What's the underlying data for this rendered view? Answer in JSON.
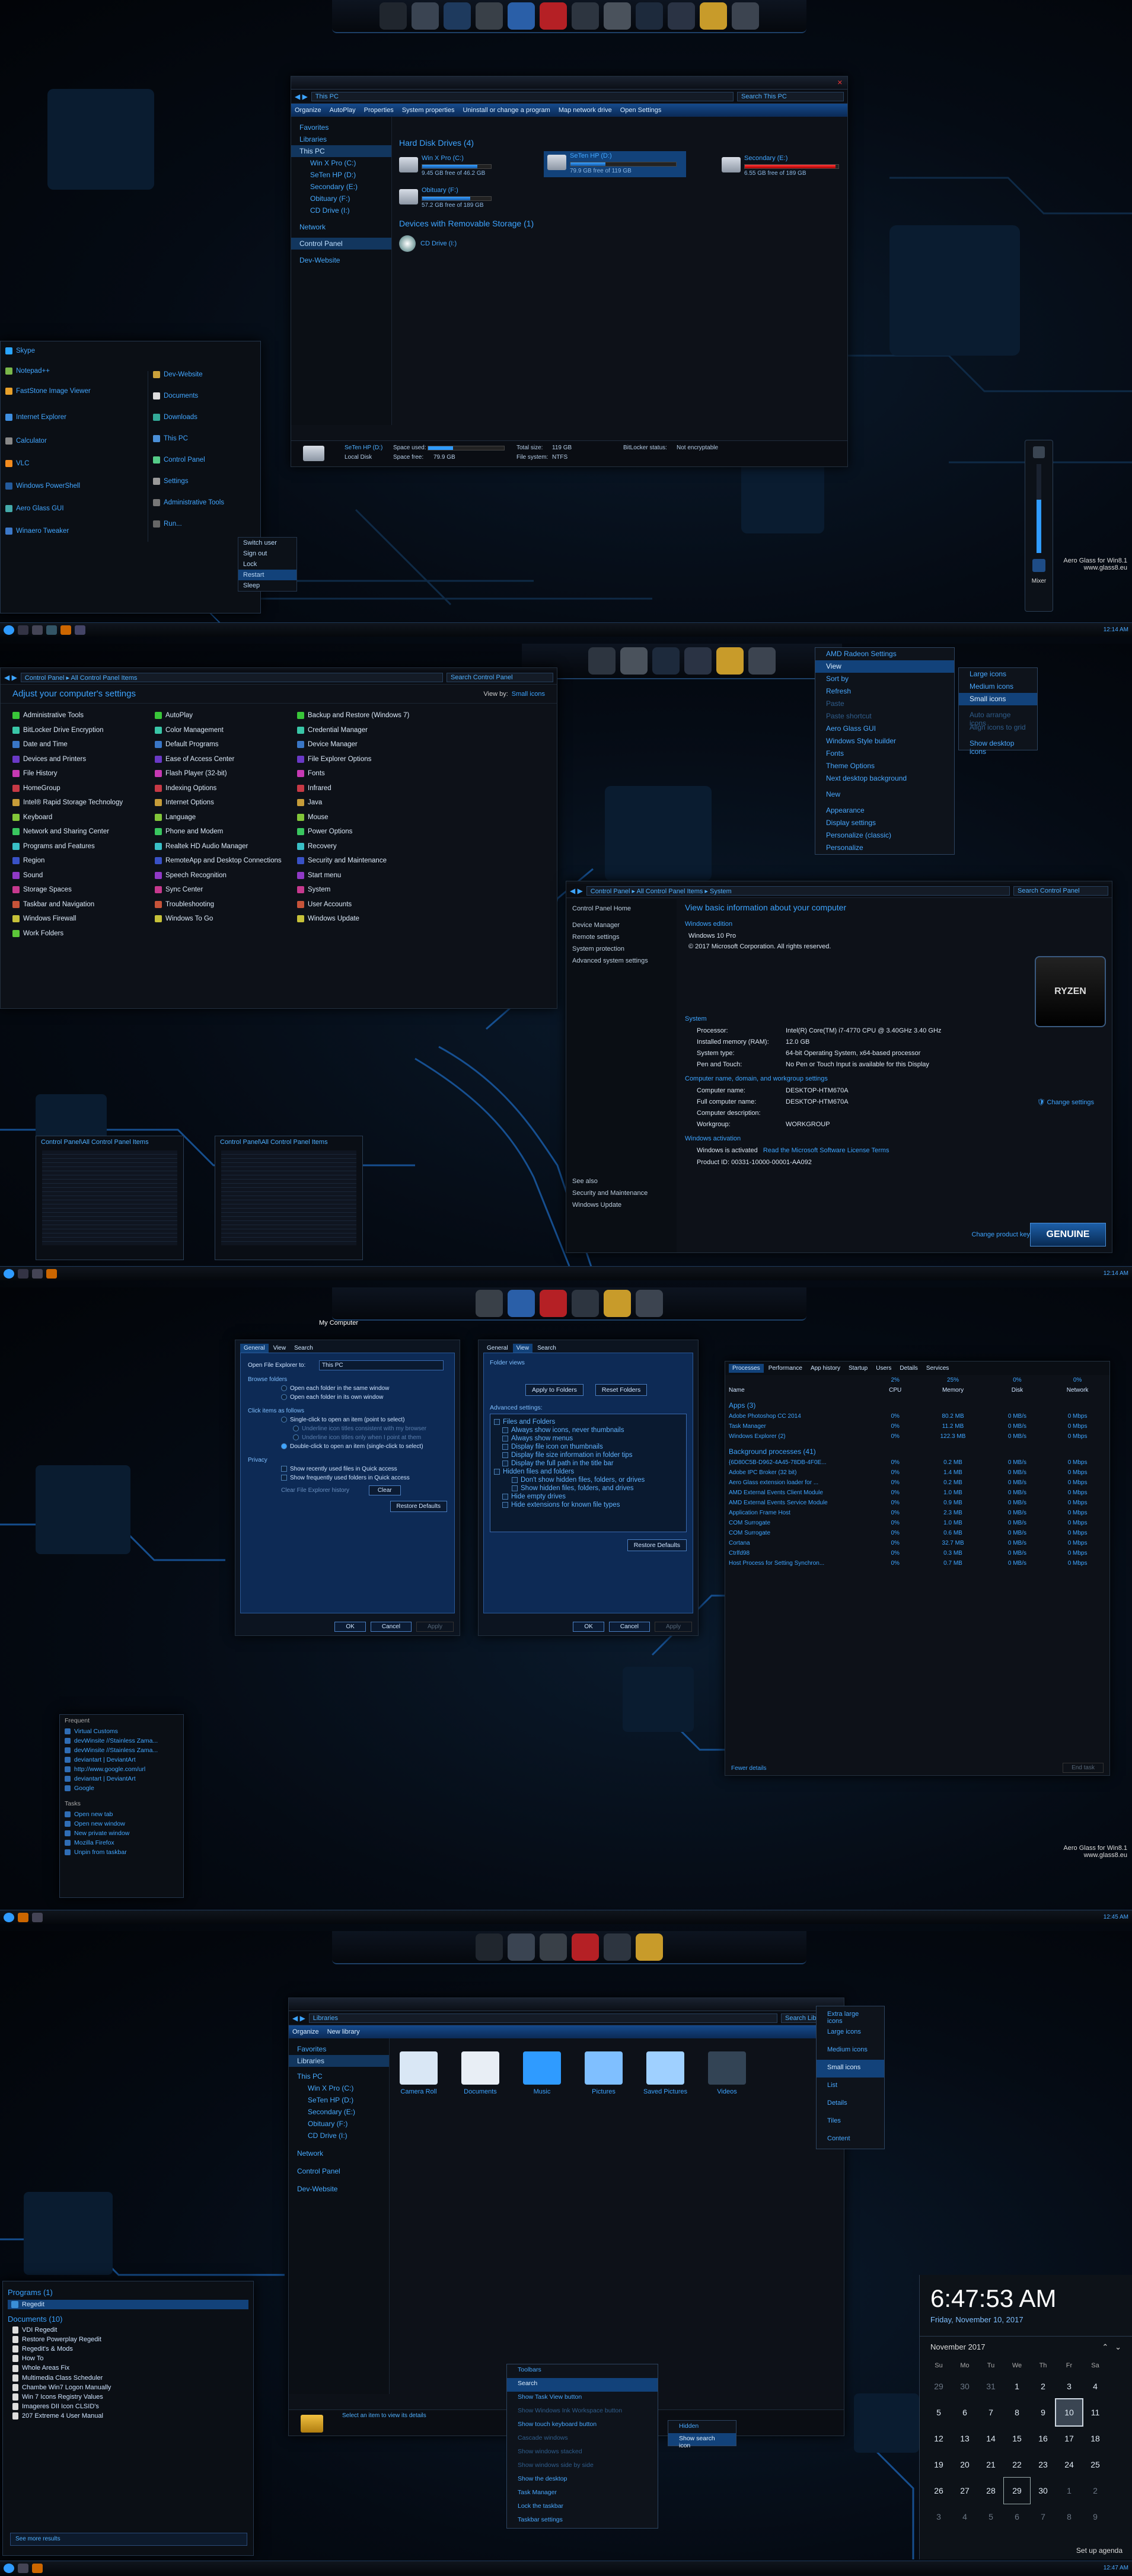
{
  "colors": {
    "accent": "#2f9bff",
    "selection": "#12427a",
    "background": "#03070d"
  },
  "taskbar": {
    "clock1": "12:14 AM",
    "clock2": "12:14 AM",
    "clock3": "12:45 AM",
    "clock4": "12:47 AM"
  },
  "panel1": {
    "explorer": {
      "title": "This PC",
      "search": "Search This PC",
      "commands": [
        "Organize",
        "AutoPlay",
        "Properties",
        "System properties",
        "Uninstall or change a program",
        "Map network drive",
        "Open Settings"
      ],
      "nav": [
        "Favorites",
        "Libraries",
        "This PC",
        "Win X Pro (C:)",
        "SeTen HP (D:)",
        "Secondary (E:)",
        "Obituary (F:)",
        "CD Drive (I:)",
        "Network",
        "Control Panel",
        "Dev-Website"
      ],
      "group_hdd": "Hard Disk Drives (4)",
      "group_removable": "Devices with Removable Storage (1)",
      "drives": [
        {
          "name": "Win X Pro (C:)",
          "free": "9.45 GB free of 46.2 GB",
          "fill": 0.8
        },
        {
          "name": "SeTen HP (D:)",
          "free": "79.9 GB free of 119 GB",
          "fill": 0.33
        },
        {
          "name": "Secondary (E:)",
          "free": "6.55 GB free of 189 GB",
          "fill": 0.97
        },
        {
          "name": "Obituary (F:)",
          "free": "57.2 GB free of 189 GB",
          "fill": 0.7
        }
      ],
      "cd": "CD Drive (I:)",
      "details": {
        "name": "SeTen HP (D:)",
        "type": "Local Disk",
        "used_label": "Space used:",
        "free_label": "Space free:",
        "free": "79.9 GB",
        "total_label": "Total size:",
        "total": "119 GB",
        "fs_label": "File system:",
        "fs": "NTFS",
        "bitlocker_label": "BitLocker status:",
        "bitlocker": "Not encryptable"
      }
    },
    "start": {
      "left": [
        "Skype",
        "Notepad++",
        "FastStone Image Viewer",
        "Internet Explorer",
        "Calculator",
        "VLC",
        "Windows PowerShell",
        "Aero Glass GUI",
        "Winaero Tweaker"
      ],
      "right": [
        "Dev-Website",
        "Documents",
        "Downloads",
        "This PC",
        "Control Panel",
        "Settings",
        "Administrative Tools",
        "Run..."
      ],
      "power": [
        "Switch user",
        "Sign out",
        "Lock",
        "Restart",
        "Sleep"
      ]
    },
    "mixer": "Mixer",
    "watermark": [
      "Aero Glass for Win8.1",
      "www.glass8.eu"
    ]
  },
  "panel2": {
    "cp": {
      "title": "Control Panel",
      "title2": "All Control Panel Items",
      "search": "Search Control Panel",
      "heading": "Adjust your computer's settings",
      "viewby": "View by:",
      "viewby_value": "Small icons",
      "col1": [
        "Administrative Tools",
        "BitLocker Drive Encryption",
        "Date and Time",
        "Devices and Printers",
        "File History",
        "HomeGroup",
        "Intel® Rapid Storage Technology",
        "Keyboard",
        "Network and Sharing Center",
        "Programs and Features",
        "Region",
        "Sound",
        "Storage Spaces",
        "Taskbar and Navigation",
        "Windows Firewall",
        "Work Folders"
      ],
      "col2": [
        "AutoPlay",
        "Color Management",
        "Default Programs",
        "Ease of Access Center",
        "Flash Player (32-bit)",
        "Indexing Options",
        "Internet Options",
        "Language",
        "Phone and Modem",
        "Realtek HD Audio Manager",
        "RemoteApp and Desktop Connections",
        "Speech Recognition",
        "Sync Center",
        "Troubleshooting",
        "Windows To Go"
      ],
      "col3": [
        "Backup and Restore (Windows 7)",
        "Credential Manager",
        "Device Manager",
        "File Explorer Options",
        "Fonts",
        "Infrared",
        "Java",
        "Mouse",
        "Power Options",
        "Recovery",
        "Security and Maintenance",
        "Start menu",
        "System",
        "User Accounts",
        "Windows Update"
      ]
    },
    "thumbs": [
      "Control Panel\\All Control Panel Items",
      "Control Panel\\All Control Panel Items"
    ],
    "ctx": {
      "items": [
        "AMD Radeon Settings",
        "View",
        "Sort by",
        "Refresh",
        "Paste",
        "Paste shortcut",
        "Aero Glass GUI",
        "Windows Style builder",
        "Fonts",
        "Theme Options",
        "Next desktop background",
        "New",
        "Appearance",
        "Display settings",
        "Personalize (classic)",
        "Personalize"
      ],
      "view": [
        "Large icons",
        "Medium icons",
        "Small icons",
        "Auto arrange icons",
        "Align icons to grid",
        "Show desktop icons"
      ]
    },
    "sys": {
      "crumbs": [
        "Control Panel",
        "All Control Panel Items",
        "System"
      ],
      "search": "Search Control Panel",
      "left": [
        "Control Panel Home",
        "Device Manager",
        "Remote settings",
        "System protection",
        "Advanced system settings"
      ],
      "seealso": "See also",
      "seealso_items": [
        "Security and Maintenance",
        "Windows Update"
      ],
      "heading": "View basic information about your computer",
      "edition_h": "Windows edition",
      "edition": "Windows 10 Pro",
      "copyright": "© 2017 Microsoft Corporation. All rights reserved.",
      "system_h": "System",
      "rows": [
        [
          "Processor:",
          "Intel(R) Core(TM) i7-4770 CPU @ 3.40GHz   3.40 GHz"
        ],
        [
          "Installed memory (RAM):",
          "12.0 GB"
        ],
        [
          "System type:",
          "64-bit Operating System, x64-based processor"
        ],
        [
          "Pen and Touch:",
          "No Pen or Touch Input is available for this Display"
        ]
      ],
      "name_h": "Computer name, domain, and workgroup settings",
      "rows2": [
        [
          "Computer name:",
          "DESKTOP-HTM670A"
        ],
        [
          "Full computer name:",
          "DESKTOP-HTM670A"
        ],
        [
          "Computer description:",
          ""
        ],
        [
          "Workgroup:",
          "WORKGROUP"
        ]
      ],
      "change": "Change settings",
      "act_h": "Windows activation",
      "act": "Windows is activated",
      "act_link": "Read the Microsoft Software License Terms",
      "pid": "Product ID: 00331-10000-00001-AA092",
      "change_key": "Change product key",
      "genuine": "GENUINE",
      "ryzen": "RYZEN"
    }
  },
  "panel3": {
    "mycomp": "My Computer",
    "fo": {
      "tabs": [
        "General",
        "View",
        "Search"
      ],
      "browse": "Browse folders",
      "b1": "Open each folder in the same window",
      "b2": "Open each folder in its own window",
      "click": "Click items as follows",
      "c1": "Single-click to open an item (point to select)",
      "c2": "Underline icon titles consistent with my browser",
      "c3": "Underline icon titles only when I point at them",
      "c4": "Double-click to open an item (single-click to select)",
      "privacy": "Privacy",
      "p1": "Show recently used files in Quick access",
      "p2": "Show frequently used folders in Quick access",
      "clear_h": "Clear File Explorer history",
      "clear": "Clear",
      "restore": "Restore Defaults",
      "ok": "OK",
      "cancel": "Cancel",
      "apply": "Apply",
      "open_label": "Open File Explorer to:",
      "open_value": "This PC"
    },
    "fv": {
      "folder_views": "Folder views",
      "apply": "Apply to Folders",
      "reset": "Reset Folders",
      "adv": "Advanced settings:",
      "items": [
        "Files and Folders",
        "Always show icons, never thumbnails",
        "Always show menus",
        "Display file icon on thumbnails",
        "Display file size information in folder tips",
        "Display the full path in the title bar",
        "Hidden files and folders",
        "Don't show hidden files, folders, or drives",
        "Show hidden files, folders, and drives",
        "Hide empty drives",
        "Hide extensions for known file types"
      ],
      "restore": "Restore Defaults",
      "ok": "OK",
      "cancel": "Cancel",
      "apply2": "Apply"
    },
    "tm": {
      "tabs": [
        "Processes",
        "Performance",
        "App history",
        "Startup",
        "Users",
        "Details",
        "Services"
      ],
      "headers": [
        "Name",
        "CPU",
        "Memory",
        "Disk",
        "Network"
      ],
      "pcts": [
        "2%",
        "25%",
        "0%",
        "0%"
      ],
      "apps_h": "Apps (3)",
      "apps": [
        [
          "Adobe Photoshop CC 2014",
          "0%",
          "80.2 MB",
          "0 MB/s",
          "0 Mbps"
        ],
        [
          "Task Manager",
          "0%",
          "11.2 MB",
          "0 MB/s",
          "0 Mbps"
        ],
        [
          "Windows Explorer (2)",
          "0%",
          "122.3 MB",
          "0 MB/s",
          "0 Mbps"
        ]
      ],
      "bg_h": "Background processes (41)",
      "bg": [
        [
          "{6D80C5B-D962-4A45-78DB-4F0E...",
          "0%",
          "0.2 MB",
          "0 MB/s",
          "0 Mbps"
        ],
        [
          "Adobe IPC Broker (32 bit)",
          "0%",
          "1.4 MB",
          "0 MB/s",
          "0 Mbps"
        ],
        [
          "Aero Glass extension loader for ...",
          "0%",
          "0.2 MB",
          "0 MB/s",
          "0 Mbps"
        ],
        [
          "AMD External Events Client Module",
          "0%",
          "1.0 MB",
          "0 MB/s",
          "0 Mbps"
        ],
        [
          "AMD External Events Service Module",
          "0%",
          "0.9 MB",
          "0 MB/s",
          "0 Mbps"
        ],
        [
          "Application Frame Host",
          "0%",
          "2.3 MB",
          "0 MB/s",
          "0 Mbps"
        ],
        [
          "COM Surrogate",
          "0%",
          "1.0 MB",
          "0 MB/s",
          "0 Mbps"
        ],
        [
          "COM Surrogate",
          "0%",
          "0.6 MB",
          "0 MB/s",
          "0 Mbps"
        ],
        [
          "Cortana",
          "0%",
          "32.7 MB",
          "0 MB/s",
          "0 Mbps"
        ],
        [
          "Ctrlfd98",
          "0%",
          "0.3 MB",
          "0 MB/s",
          "0 Mbps"
        ],
        [
          "Host Process for Setting Synchron...",
          "0%",
          "0.7 MB",
          "0 MB/s",
          "0 Mbps"
        ]
      ],
      "fewer": "Fewer details",
      "end": "End task"
    },
    "jump": {
      "frequent": "Frequent",
      "items": [
        "Virtual Customs",
        "devWinsite //Stainless Zama...",
        "devWinsite //Stainless Zama...",
        "deviantart | DeviantArt",
        "http://www.google.com/url",
        "deviantart | DeviantArt",
        "Google"
      ],
      "tasks": "Tasks",
      "tasks_items": [
        "Open new tab",
        "Open new window",
        "New private window",
        "Mozilla Firefox",
        "Unpin from taskbar"
      ]
    },
    "watermark": [
      "Aero Glass for Win8.1",
      "www.glass8.eu"
    ]
  },
  "panel4": {
    "lib": {
      "title": "Libraries",
      "search": "Search Libraries",
      "commands": [
        "Organize",
        "New library"
      ],
      "nav": [
        "Favorites",
        "Libraries",
        "This PC",
        "Win X Pro (C:)",
        "SeTen HP (D:)",
        "Secondary (E:)",
        "Obituary (F:)",
        "CD Drive (I:)",
        "Network",
        "Control Panel",
        "Dev-Website"
      ],
      "items": [
        "Camera Roll",
        "Documents",
        "Music",
        "Pictures",
        "Saved Pictures",
        "Videos"
      ],
      "viewmenu": [
        "Extra large icons",
        "Large icons",
        "Medium icons",
        "Small icons",
        "List",
        "Details",
        "Tiles",
        "Content"
      ],
      "status": "Select an item to view its details"
    },
    "startsearch": {
      "programs": "Programs (1)",
      "program": "Regedit",
      "documents": "Documents (10)",
      "docs": [
        "VDI Regedit",
        "Restore Powerplay Regedit",
        "Regedit's & Mods",
        "How To",
        "Whole Areas Fix",
        "Multimedia Class Scheduler",
        "Chambe Win7 Logon Manually",
        "Win 7 Icons Registry Values",
        "Imageres DII Icon CLSID's",
        "207 Extreme 4 User Manual"
      ],
      "see_more": "See more results"
    },
    "tbmenu": {
      "items": [
        "Toolbars",
        "Search",
        "Show Task View button",
        "Show Windows Ink Workspace button",
        "Show touch keyboard button",
        "Cascade windows",
        "Show windows stacked",
        "Show windows side by side",
        "Show the desktop",
        "Task Manager",
        "Lock the taskbar",
        "Taskbar settings"
      ],
      "sub": [
        "Hidden",
        "Show search icon"
      ]
    },
    "clock": {
      "time": "6:47:53 AM",
      "date": "Friday, November 10, 2017",
      "month": "November 2017",
      "days": [
        "Su",
        "Mo",
        "Tu",
        "We",
        "Th",
        "Fr",
        "Sa"
      ],
      "weeks": [
        [
          "29",
          "30",
          "31",
          "1",
          "2",
          "3",
          "4"
        ],
        [
          "5",
          "6",
          "7",
          "8",
          "9",
          "10",
          "11"
        ],
        [
          "12",
          "13",
          "14",
          "15",
          "16",
          "17",
          "18"
        ],
        [
          "19",
          "20",
          "21",
          "22",
          "23",
          "24",
          "25"
        ],
        [
          "26",
          "27",
          "28",
          "29",
          "30",
          "1",
          "2"
        ],
        [
          "3",
          "4",
          "5",
          "6",
          "7",
          "8",
          "9"
        ]
      ],
      "agenda": "Set up agenda"
    }
  }
}
